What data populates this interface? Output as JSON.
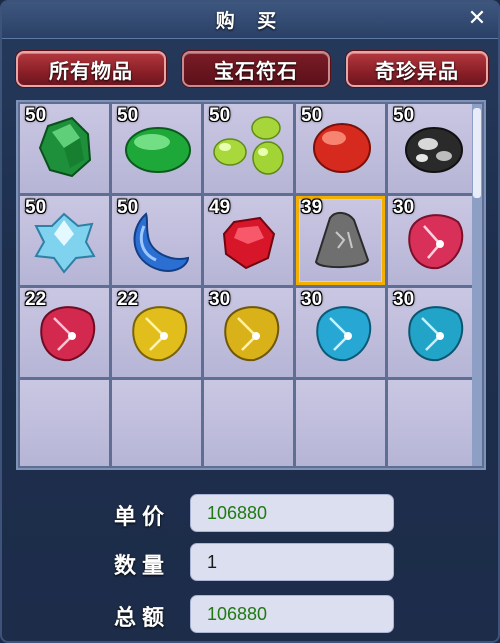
{
  "window": {
    "title": "购 买",
    "close_glyph": "✕"
  },
  "tabs": [
    {
      "label": "所有物品",
      "active": false
    },
    {
      "label": "宝石符石",
      "active": true
    },
    {
      "label": "奇珍异品",
      "active": false
    }
  ],
  "items": [
    {
      "qty": "50",
      "icon": "green-crystal-gem-icon"
    },
    {
      "qty": "50",
      "icon": "green-oval-gem-icon"
    },
    {
      "qty": "50",
      "icon": "green-pearls-icon"
    },
    {
      "qty": "50",
      "icon": "red-oval-gem-icon"
    },
    {
      "qty": "50",
      "icon": "black-white-stone-icon"
    },
    {
      "qty": "50",
      "icon": "ice-crystal-icon"
    },
    {
      "qty": "50",
      "icon": "blue-crescent-gem-icon"
    },
    {
      "qty": "49",
      "icon": "red-ruby-icon"
    },
    {
      "qty": "39",
      "icon": "grey-rune-stone-icon",
      "selected": true
    },
    {
      "qty": "30",
      "icon": "pink-rune-stone-icon"
    },
    {
      "qty": "22",
      "icon": "red-rune-stone-icon"
    },
    {
      "qty": "22",
      "icon": "yellow-rune-stone-icon"
    },
    {
      "qty": "30",
      "icon": "gold-rune-stone-icon"
    },
    {
      "qty": "30",
      "icon": "cyan-rune-stone-icon"
    },
    {
      "qty": "30",
      "icon": "teal-rune-stone-icon"
    }
  ],
  "purchase": {
    "unit_price_label": "单价",
    "unit_price": "106880",
    "quantity_label": "数量",
    "quantity": "1",
    "total_label": "总额",
    "total": "106880"
  },
  "colors": {
    "tab_red": "#8a1f27",
    "price_green": "#1f7a12",
    "selection_gold": "#f4b000"
  }
}
